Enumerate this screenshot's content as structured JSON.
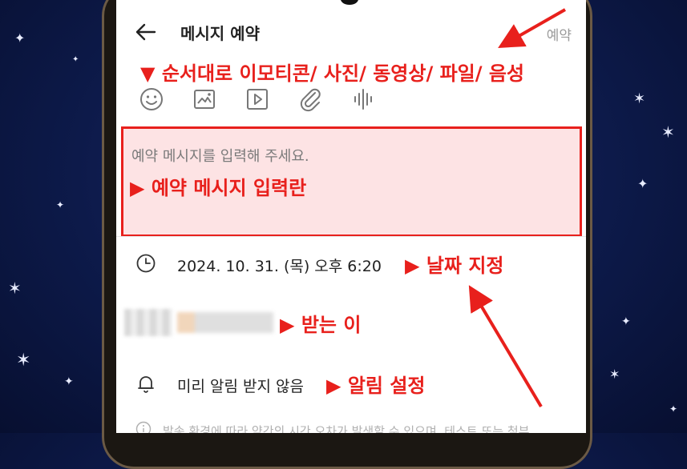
{
  "header": {
    "title": "메시지 예약",
    "reserve_label": "예약"
  },
  "annotations": {
    "toolbar_note": "▼ 순서대로 이모티콘/ 사진/ 동영상/ 파일/ 음성",
    "message_note": "▶ 예약 메시지 입력란",
    "date_note": "▶ 날짜 지정",
    "recipient_note": "▶ 받는 이",
    "alarm_note": "▶ 알림 설정"
  },
  "toolbar_icons": [
    "emoji-icon",
    "photo-icon",
    "video-icon",
    "attachment-icon",
    "voice-icon"
  ],
  "message": {
    "placeholder": "예약 메시지를 입력해 주세요."
  },
  "schedule": {
    "datetime": "2024. 10. 31. (목) 오후 6:20"
  },
  "alarm": {
    "label": "미리 알림 받지 않음"
  },
  "notice": {
    "text": "발송 환경에 따라 약간의 시간 오차가 발생할 수 있으며, 테스트 또는 첨부"
  },
  "colors": {
    "annotation": "#e8201c",
    "message_box_bg": "#fde3e4",
    "background": "#0d1a4a"
  }
}
